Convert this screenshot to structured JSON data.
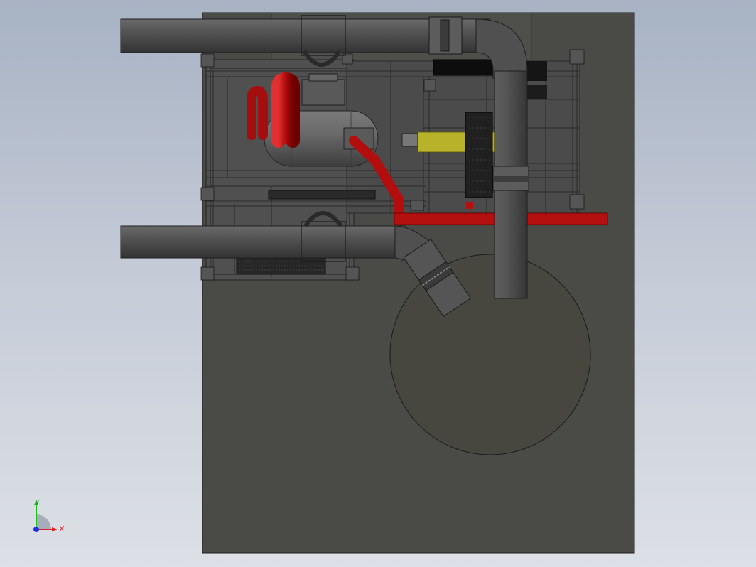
{
  "viewport": {
    "background_top": "#a7b2c3",
    "background_bottom": "#dde0e6"
  },
  "model": {
    "plate_color": "#4a4a47",
    "pipe_color": "#4f4f4f",
    "frame_color": "#5a5a5a",
    "red_pipe_color": "#c31010",
    "yellow_part_color": "#b8b22a",
    "tank_color": "#6a6a6a"
  },
  "triad": {
    "x_label": "X",
    "y_label": "Y",
    "x_color": "#e02020",
    "y_color": "#20c020",
    "z_color": "#2030e0"
  }
}
